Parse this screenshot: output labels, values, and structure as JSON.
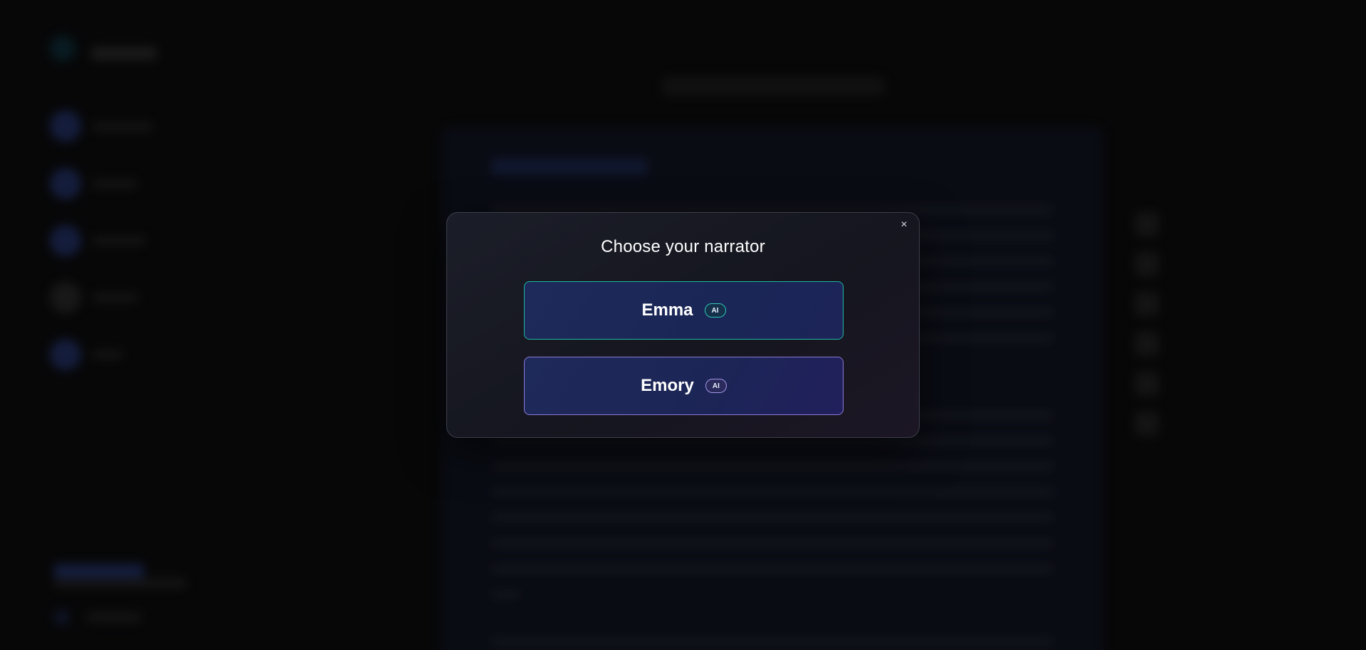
{
  "dialog": {
    "title": "Choose your narrator",
    "close_label": "×",
    "options": [
      {
        "name": "Emma",
        "badge": "AI",
        "accent": "#1fb7a0"
      },
      {
        "name": "Emory",
        "badge": "AI",
        "accent": "#8c7ad8"
      }
    ]
  },
  "colors": {
    "page_background": "#0a0a0b",
    "modal_background": "#17181f",
    "option_background": "#1d2858"
  }
}
